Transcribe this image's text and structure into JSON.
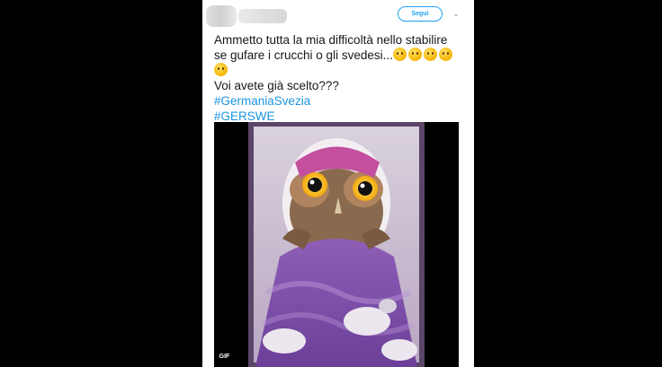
{
  "tweet": {
    "follow_label": "Segui",
    "text_lines": [
      "Ammetto tutta la mia difficoltà nello stabilire",
      "se gufare i crucchi o gli svedesi..."
    ],
    "question": "Voi avete già scelto???",
    "hashtags": [
      "#GermaniaSvezia",
      "#GERSWE"
    ],
    "emoji": "thinking-face-icon"
  },
  "media": {
    "badge": "GIF",
    "description_icon": "owl-in-bed-image"
  },
  "colors": {
    "hashtag": "#1b95e0",
    "follow": "#1da1f2",
    "text": "#14171a"
  }
}
